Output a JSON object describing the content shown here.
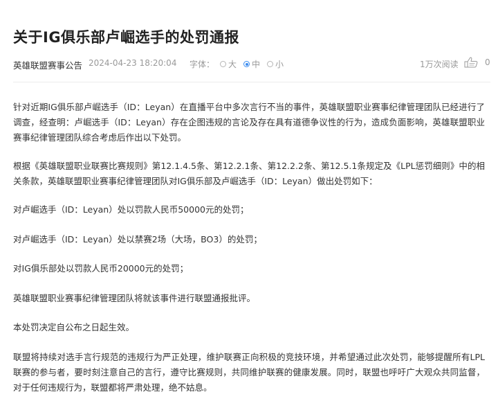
{
  "article": {
    "title": "关于IG俱乐部卢崛选手的处罚通报",
    "author": "英雄联盟赛事公告",
    "date": "2024-04-23 18:20:04",
    "font_size": {
      "label": "字体：",
      "options": [
        "大",
        "中",
        "小"
      ],
      "selected": "中"
    },
    "reads": "1万次阅读",
    "likes": "0",
    "paragraphs": [
      "针对近期IG俱乐部卢崛选手（ID：Leyan）在直播平台中多次言行不当的事件，英雄联盟职业赛事纪律管理团队已经进行了调查，经查明：卢崛选手（ID：Leyan）存在企图违规的言论及存在具有道德争议性的行为，造成负面影响，英雄联盟职业赛事纪律管理团队综合考虑后作出以下处罚。",
      "根据《英雄联盟职业联赛比赛规则》第12.1.4.5条、第12.2.1条、第12.2.2条、第12.5.1条规定及《LPL惩罚细则》中的相关条款，英雄联盟职业赛事纪律管理团队对IG俱乐部及卢崛选手（ID：Leyan）做出处罚如下：",
      "对卢崛选手（ID：Leyan）处以罚款人民币50000元的处罚；",
      "对卢崛选手（ID：Leyan）处以禁赛2场（大场，BO3）的处罚；",
      "对IG俱乐部处以罚款人民币20000元的处罚；",
      "英雄联盟职业赛事纪律管理团队将就该事件进行联盟通报批评。",
      "本处罚决定自公布之日起生效。",
      "联盟将持续对选手言行规范的违规行为严正处理，维护联赛正向积极的竞技环境，并希望通过此次处罚，能够提醒所有LPL联赛的参与者，要时刻注意自己的言行，遵守比赛规则，共同维护联赛的健康发展。同时，联盟也呼吁广大观众共同监督，对于任何违规行为，联盟都将严肃处理，绝不姑息。"
    ]
  },
  "colors": {
    "text": "#333333",
    "muted": "#999999",
    "accent": "#3b8cf0"
  },
  "icons": {
    "like": "thumbs-up-icon"
  }
}
